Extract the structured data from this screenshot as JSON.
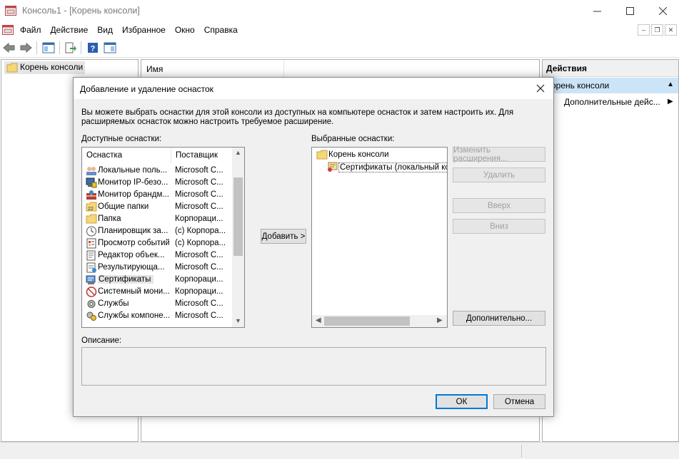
{
  "window": {
    "title": "Консоль1 - [Корень консоли]"
  },
  "menu": {
    "items": [
      "Файл",
      "Действие",
      "Вид",
      "Избранное",
      "Окно",
      "Справка"
    ]
  },
  "tree": {
    "root": "Корень консоли"
  },
  "center": {
    "name_header": "Имя"
  },
  "actions": {
    "header": "Действия",
    "selected": "Корень консоли",
    "item": "Дополнительные дейс..."
  },
  "dialog": {
    "title": "Добавление и удаление оснасток",
    "intro": "Вы можете выбрать оснастки для этой консоли из доступных на компьютере оснасток и затем настроить их. Для расширяемых оснасток можно настроить требуемое расширение.",
    "available_label": "Доступные оснастки:",
    "selected_label": "Выбранные оснастки:",
    "columns": {
      "snapin": "Оснастка",
      "vendor": "Поставщик"
    },
    "snapins": [
      {
        "name": "Локальные поль...",
        "vendor": "Microsoft C...",
        "icon": "users-icon"
      },
      {
        "name": "Монитор IP-безо...",
        "vendor": "Microsoft C...",
        "icon": "ipsec-monitor-icon"
      },
      {
        "name": "Монитор брандм...",
        "vendor": "Microsoft C...",
        "icon": "firewall-icon"
      },
      {
        "name": "Общие папки",
        "vendor": "Microsoft C...",
        "icon": "shared-folders-icon"
      },
      {
        "name": "Папка",
        "vendor": "Корпорaци...",
        "icon": "folder-icon"
      },
      {
        "name": "Планировщик за...",
        "vendor": "(c) Корпора...",
        "icon": "clock-icon"
      },
      {
        "name": "Просмотр событий",
        "vendor": "(c) Корпора...",
        "icon": "event-viewer-icon"
      },
      {
        "name": "Редактор объек...",
        "vendor": "Microsoft C...",
        "icon": "policy-editor-icon"
      },
      {
        "name": "Результирующа...",
        "vendor": "Microsoft C...",
        "icon": "rsop-icon"
      },
      {
        "name": "Сертификаты",
        "vendor": "Корпорaци...",
        "icon": "certificate-icon",
        "selected": true
      },
      {
        "name": "Системный мони...",
        "vendor": "Корпорaци...",
        "icon": "system-monitor-icon"
      },
      {
        "name": "Службы",
        "vendor": "Microsoft C...",
        "icon": "services-icon"
      },
      {
        "name": "Службы компоне...",
        "vendor": "Microsoft C...",
        "icon": "component-services-icon"
      }
    ],
    "selected_tree": {
      "root": "Корень консоли",
      "child": "Сертификаты (локальный ко"
    },
    "add_button": "Добавить >",
    "edit_extensions_button": "Изменить расширения...",
    "remove_button": "Удалить",
    "up_button": "Вверх",
    "down_button": "Вниз",
    "advanced_button": "Дополнительно...",
    "description_label": "Описание:",
    "ok_button": "ОК",
    "cancel_button": "Отмена"
  }
}
